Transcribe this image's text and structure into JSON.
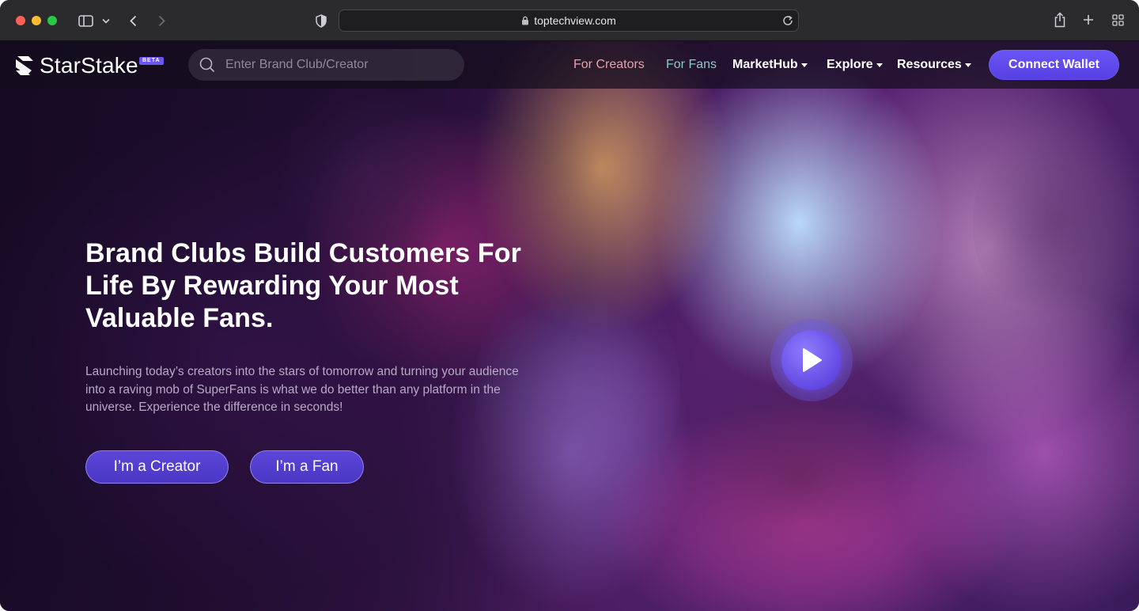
{
  "browser": {
    "url": "toptechview.com",
    "icons": {
      "sidebar": "sidebar-icon",
      "sidebar_menu": "chevron-down-icon",
      "back": "chevron-left-icon",
      "forward": "chevron-right-icon",
      "privacy": "shield-icon",
      "lock": "lock-icon",
      "reload": "reload-icon",
      "share": "share-icon",
      "new_tab": "plus-icon",
      "tab_overview": "grid-icon"
    }
  },
  "navbar": {
    "logo_text": "StarStake",
    "beta_label": "BETA",
    "search_placeholder": "Enter Brand Club/Creator",
    "links": {
      "for_creators": "For Creators",
      "for_fans": "For Fans",
      "markethub": "MarketHub",
      "explore": "Explore",
      "resources": "Resources"
    },
    "connect_wallet": "Connect Wallet"
  },
  "hero": {
    "title": "Brand Clubs Build Customers For Life By Rewarding Your Most Valuable Fans.",
    "subtitle": "Launching today’s creators into the stars of tomorrow and turning your audience into a raving mob of SuperFans is what we do better than any platform in the universe. Experience the difference in seconds!",
    "creator_button": "I’m a Creator",
    "fan_button": "I’m a Fan",
    "play_icon": "play-icon"
  },
  "colors": {
    "accent": "#5b46e0",
    "for_creators": "#e7a0b0",
    "for_fans": "#8fc6c8"
  }
}
